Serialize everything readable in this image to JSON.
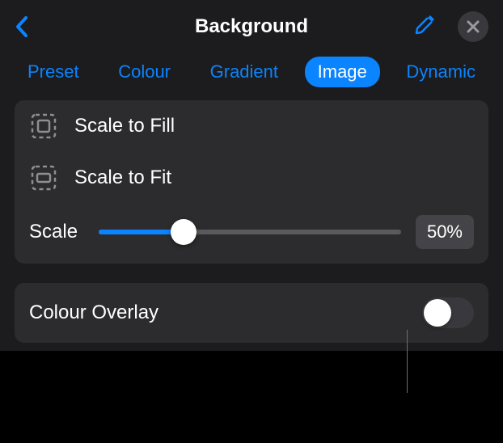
{
  "header": {
    "title": "Background"
  },
  "tabs": {
    "items": [
      {
        "label": "Preset"
      },
      {
        "label": "Colour"
      },
      {
        "label": "Gradient"
      },
      {
        "label": "Image"
      },
      {
        "label": "Dynamic"
      }
    ],
    "active_index": 3
  },
  "options": {
    "scale_to_fill": "Scale to Fill",
    "scale_to_fit": "Scale to Fit"
  },
  "scale": {
    "label": "Scale",
    "value_text": "50%",
    "percent": 50
  },
  "overlay": {
    "label": "Colour Overlay",
    "on": false
  }
}
